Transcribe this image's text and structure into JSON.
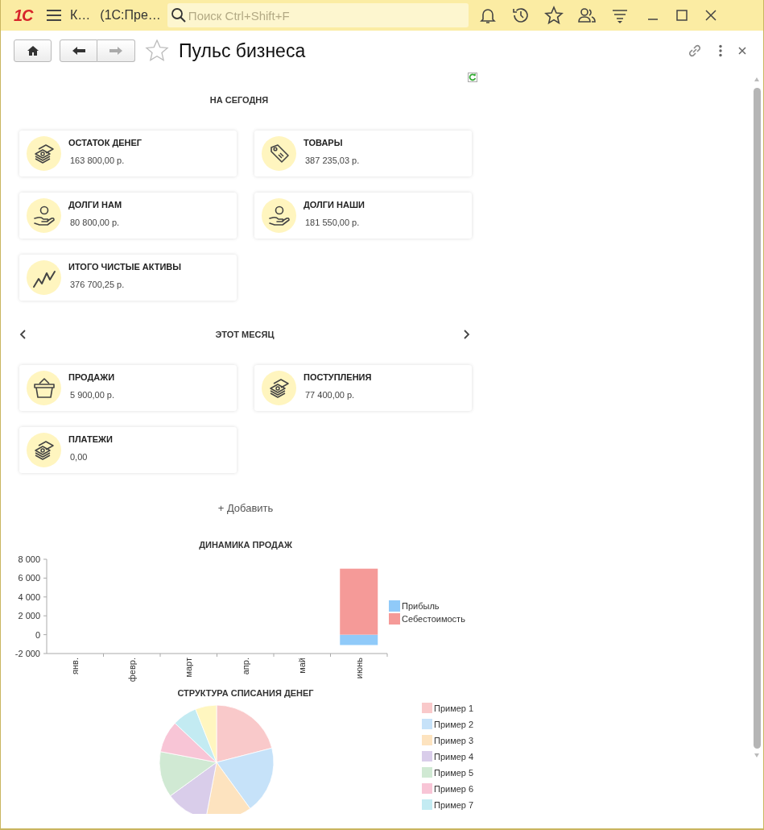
{
  "window": {
    "logo": "1С",
    "title": "К…",
    "subtitle": "(1С:Пре…",
    "search": {
      "placeholder": "Поиск Ctrl+Shift+F"
    }
  },
  "toolbar": {
    "title": "Пульс бизнеса",
    "forward_disabled": true
  },
  "sections": [
    {
      "heading": "НА СЕГОДНЯ",
      "nav": false,
      "cards": [
        {
          "kind": "money",
          "title": "ОСТАТОК ДЕНЕГ",
          "value": "163 800,00 р."
        },
        {
          "kind": "tag",
          "title": "ТОВАРЫ",
          "value": "387 235,03 р."
        },
        {
          "kind": "hand",
          "title": "ДОЛГИ НАМ",
          "value": "80 800,00 р."
        },
        {
          "kind": "hand",
          "title": "ДОЛГИ НАШИ",
          "value": "181 550,00 р."
        },
        {
          "kind": "trend",
          "title": "ИТОГО ЧИСТЫЕ АКТИВЫ",
          "value": "376 700,25 р."
        }
      ]
    },
    {
      "heading": "ЭТОТ МЕСЯЦ",
      "nav": true,
      "cards": [
        {
          "kind": "basket",
          "title": "ПРОДАЖИ",
          "value": "5 900,00 р."
        },
        {
          "kind": "money",
          "title": "ПОСТУПЛЕНИЯ",
          "value": "77 400,00 р."
        },
        {
          "kind": "money",
          "title": "ПЛАТЕЖИ",
          "value": "0,00"
        }
      ]
    }
  ],
  "add_link": "+ Добавить",
  "sales_chart": {
    "chart_data": {
      "type": "bar",
      "title": "ДИНАМИКА ПРОДАЖ",
      "categories": [
        "янв.",
        "февр.",
        "март",
        "апр.",
        "май",
        "июнь"
      ],
      "stacked": true,
      "legend": true,
      "ylim": [
        -2000,
        8000
      ],
      "yticks": [
        {
          "value": -2000,
          "label": "-2 000"
        },
        {
          "value": 0,
          "label": "0"
        },
        {
          "value": 2000,
          "label": "2 000"
        },
        {
          "value": 4000,
          "label": "4 000"
        },
        {
          "value": 6000,
          "label": "6 000"
        },
        {
          "value": 8000,
          "label": "8 000"
        }
      ],
      "series": [
        {
          "name": "Прибыль",
          "color": "#90caf9",
          "values": [
            null,
            null,
            null,
            null,
            null,
            -1100
          ]
        },
        {
          "name": "Себестоимость",
          "color": "#f59a98",
          "values": [
            null,
            null,
            null,
            null,
            null,
            7000
          ]
        }
      ]
    }
  },
  "writeoff_chart": {
    "title": "СТРУКТУРА СПИСАНИЯ ДЕНЕГ",
    "legend": [
      {
        "label": "Пример 1",
        "color": "#f9c9ca"
      },
      {
        "label": "Пример 2",
        "color": "#c6e2f9"
      },
      {
        "label": "Пример 3",
        "color": "#fde3bf"
      },
      {
        "label": "Пример 4",
        "color": "#d9cdea"
      },
      {
        "label": "Пример 5",
        "color": "#d0e9d3"
      },
      {
        "label": "Пример 6",
        "color": "#f8c5d6"
      },
      {
        "label": "Пример 7",
        "color": "#c3ebf2"
      }
    ]
  }
}
